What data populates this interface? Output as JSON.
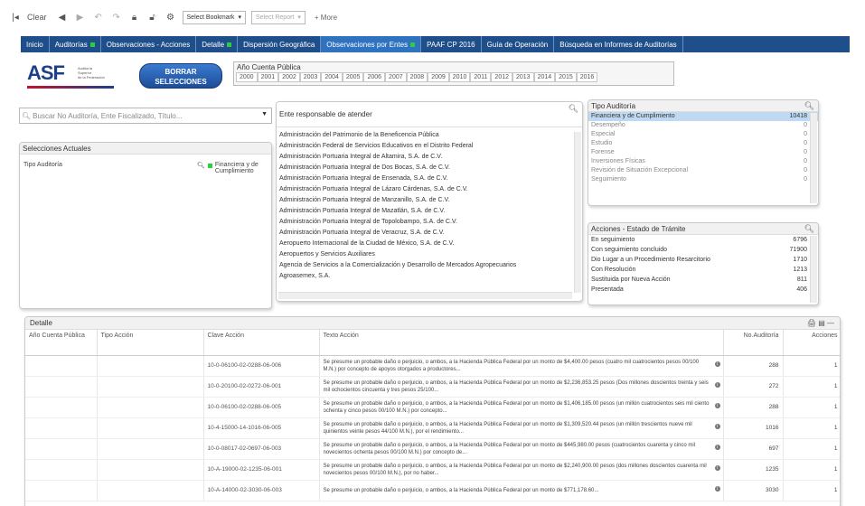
{
  "toolbar": {
    "clear_label": "Clear",
    "bookmark_select": "Select Bookmark",
    "report_select": "Select Report",
    "more_label": "More"
  },
  "tabs": [
    {
      "label": "Inicio",
      "dot": false
    },
    {
      "label": "Auditorías",
      "dot": true
    },
    {
      "label": "Observaciones - Acciones",
      "dot": false
    },
    {
      "label": "Detalle",
      "dot": true
    },
    {
      "label": "Dispersión Geográfica",
      "dot": false
    },
    {
      "label": "Observaciones por Entes",
      "dot": true
    },
    {
      "label": "PAAF CP 2016",
      "dot": false
    },
    {
      "label": "Guía de Operación",
      "dot": false
    },
    {
      "label": "Búsqueda en Informes de Auditorías",
      "dot": false
    }
  ],
  "logo": {
    "text": "ASF",
    "lines": [
      "Auditoría",
      "Superior",
      "de la Federación"
    ]
  },
  "clear_selections": {
    "line1": "BORRAR",
    "line2": "SELECCIONES"
  },
  "years": {
    "title": "Año Cuenta Pública",
    "values": [
      "2000",
      "2001",
      "2002",
      "2003",
      "2004",
      "2005",
      "2006",
      "2007",
      "2008",
      "2009",
      "2010",
      "2011",
      "2012",
      "2013",
      "2014",
      "2015",
      "2016"
    ]
  },
  "search": {
    "placeholder": "Buscar No Auditoría, Ente Fiscalizado, Título..."
  },
  "current_selections": {
    "title": "Selecciones Actuales",
    "field": "Tipo Auditoría",
    "value": "Financiera y de Cumplimiento"
  },
  "entes": {
    "title": "Ente responsable de atender",
    "items": [
      "Administración del Patrimonio de la Beneficencia Pública",
      "Administración Federal de Servicios Educativos en el Distrito Federal",
      "Administración Portuaria Integral de Altamira, S.A. de C.V.",
      "Administración Portuaria Integral de Dos Bocas, S.A. de C.V.",
      "Administración Portuaria Integral de Ensenada, S.A. de C.V.",
      "Administración Portuaria Integral de Lázaro Cárdenas, S.A. de C.V.",
      "Administración Portuaria Integral de Manzanillo, S.A. de C.V.",
      "Administración Portuaria Integral de Mazatlán, S.A. de C.V.",
      "Administración Portuaria Integral de Topolobampo, S.A. de C.V.",
      "Administración Portuaria Integral de Veracruz, S.A. de C.V.",
      "Aeropuerto Internacional de la Ciudad de México, S.A. de C.V.",
      "Aeropuertos y Servicios Auxiliares",
      "Agencia de Servicios a la Comercialización y Desarrollo de Mercados Agropecuarios",
      "Agroasemex, S.A."
    ]
  },
  "tipo_auditoria": {
    "title": "Tipo Auditoría",
    "items": [
      {
        "label": "Financiera y de Cumplimiento",
        "count": "10418",
        "selected": true
      },
      {
        "label": "Desempeño",
        "count": "0"
      },
      {
        "label": "Especial",
        "count": "0"
      },
      {
        "label": "Estudio",
        "count": "0"
      },
      {
        "label": "Forense",
        "count": "0"
      },
      {
        "label": "Inversiones Físicas",
        "count": "0"
      },
      {
        "label": "Revisión de Situación Excepcional",
        "count": "0"
      },
      {
        "label": "Seguimiento",
        "count": "0"
      }
    ]
  },
  "acciones_estado": {
    "title": "Acciones - Estado de Trámite",
    "items": [
      {
        "label": "En seguimiento",
        "count": "6796"
      },
      {
        "label": "Con seguimiento concluido",
        "count": "71900"
      },
      {
        "label": "Dio Lugar a un Procedimiento Resarcitorio",
        "count": "1710"
      },
      {
        "label": "Con Resolución",
        "count": "1213"
      },
      {
        "label": "Sustituida por Nueva Acción",
        "count": "811"
      },
      {
        "label": "Presentada",
        "count": "406"
      }
    ]
  },
  "detail": {
    "title": "Detalle",
    "columns": [
      "Año Cuenta Pública",
      "Tipo Acción",
      "Clave Acción",
      "Texto Acción",
      "No.Auditoría",
      "Acciones"
    ],
    "rows": [
      {
        "clave": "10-0-06100-02-0288-06-006",
        "texto": "Se presume un probable daño o perjuicio, o ambos, a la Hacienda Pública Federal por un monto de $4,400.00 pesos (cuatro mil cuatrocientos pesos 00/100 M.N.) por concepto de apoyos otorgados a productores...",
        "aud": "288",
        "acc": "1"
      },
      {
        "clave": "10-0-20100-02-0272-06-001",
        "texto": "Se presume un probable daño o perjuicio, o ambos, a la Hacienda Pública Federal por un monto de $2,236,853.25 pesos (Dos millones doscientos treinta y seis mil ochocientos cincuenta y tres pesos 25/100...",
        "aud": "272",
        "acc": "1"
      },
      {
        "clave": "10-0-06100-02-0288-06-005",
        "texto": "Se presume un probable daño o perjuicio, o ambos, a la Hacienda Pública Federal por un monto de $1,406,185.00 pesos (un millón cuatrocientos seis mil ciento ochenta y cinco pesos 00/100 M.N.) por concepto...",
        "aud": "288",
        "acc": "1"
      },
      {
        "clave": "10-4-15000-14-1016-06-005",
        "texto": "Se presume un probable daño o perjuicio, o ambos, a la Hacienda Pública Federal por un monto de $1,309,520.44 pesos (un millón trescientos nueve mil quinientos veinte pesos 44/100 M.N.), por el rendimiento...",
        "aud": "1016",
        "acc": "1"
      },
      {
        "clave": "10-0-08017-02-0697-06-003",
        "texto": "Se presume un probable daño o perjuicio, o ambos, a la Hacienda Pública Federal por un monto de $445,980.00 pesos (cuatrocientos cuarenta y cinco mil novecientos ochenta pesos 00/100 M.N.) por concepto de...",
        "aud": "697",
        "acc": "1"
      },
      {
        "clave": "10-A-19000-02-1235-06-001",
        "texto": "Se presume un probable daño o perjuicio, o ambos, a la Hacienda Pública Federal por un monto de $2,240,900.00 pesos (dos millones doscientos cuarenta mil novecientos pesos 00/100 M.N.), por no haber...",
        "aud": "1235",
        "acc": "1"
      },
      {
        "clave": "10-A-14000-02-3030-06-003",
        "texto": "Se presume un probable daño o perjuicio, o ambos, a la Hacienda Pública Federal por un monto de $771,178.60...",
        "aud": "3030",
        "acc": "1"
      }
    ]
  }
}
